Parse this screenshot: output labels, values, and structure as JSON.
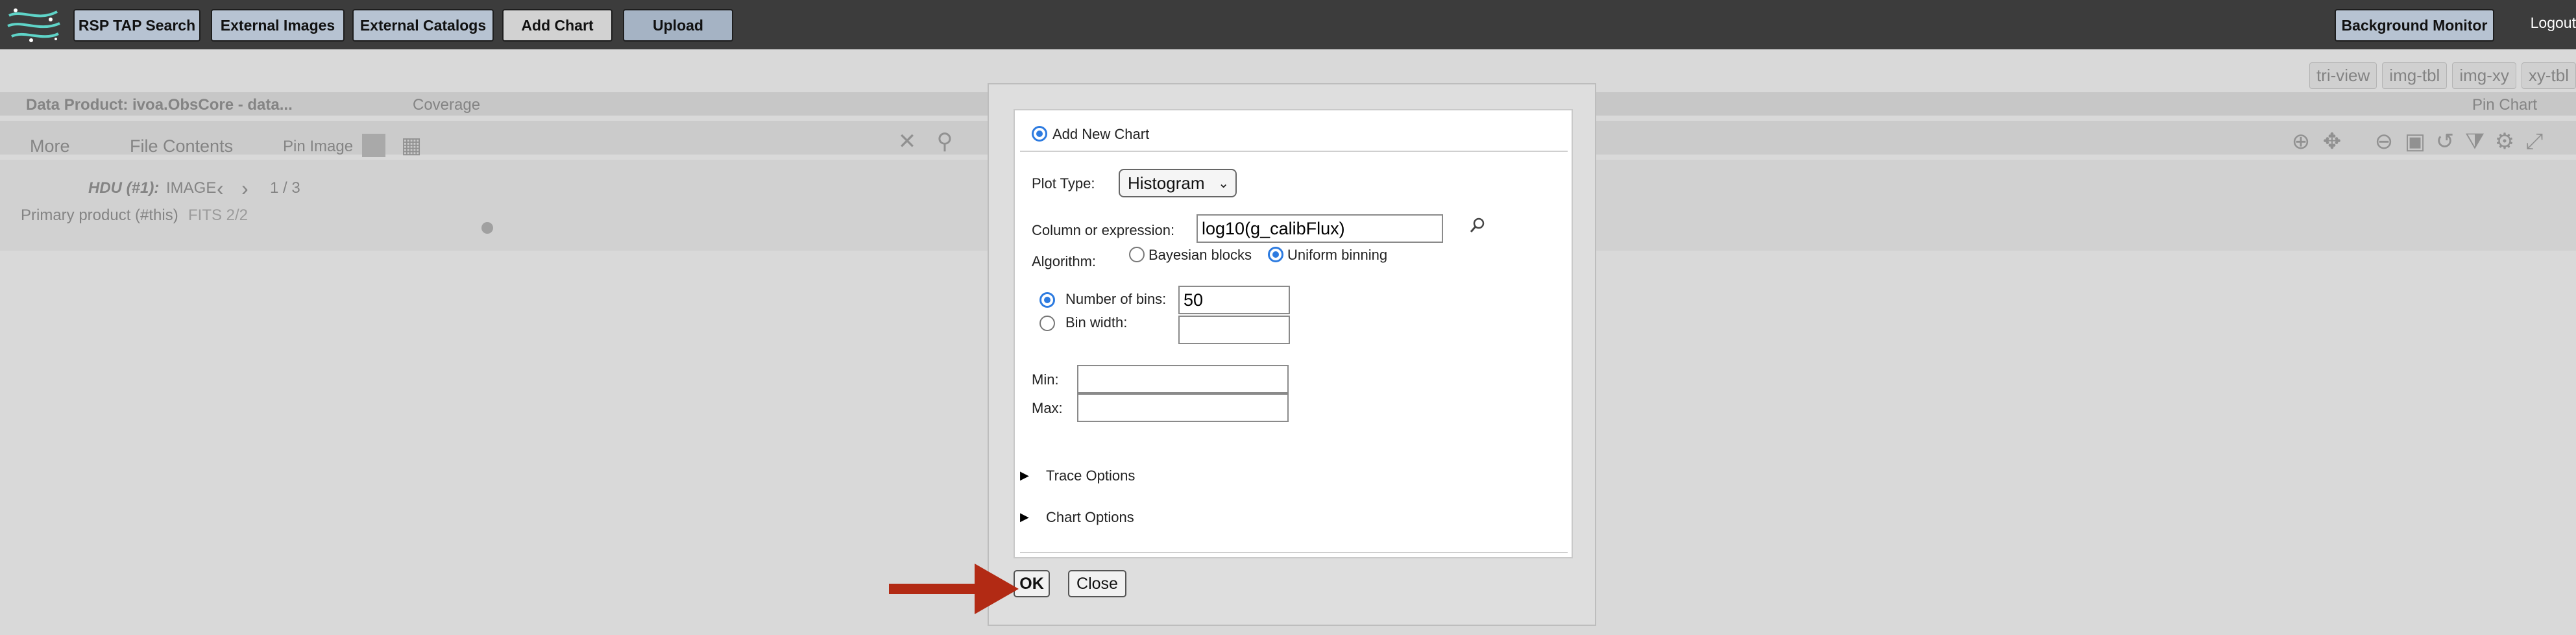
{
  "topbar": {
    "buttons": [
      "RSP TAP Search",
      "External Images",
      "External Catalogs",
      "Add Chart",
      "Upload"
    ],
    "background_monitor": "Background Monitor",
    "logout": "Logout"
  },
  "background": {
    "view_tabs": [
      "tri-view",
      "img-tbl",
      "img-xy",
      "xy-tbl"
    ],
    "data_product": "Data Product: ivoa.ObsCore - data...",
    "coverage": "Coverage",
    "pin_chart": "Pin Chart",
    "more": "More",
    "file_contents": "File Contents",
    "pin_image": "Pin Image",
    "hdu_label": "HDU (#1):",
    "hdu_type": "IMAGE",
    "hdu_page": "1 / 3",
    "primary_product": "Primary product (#this)",
    "primary_extra": "FITS 2/2"
  },
  "dialog": {
    "add_new_chart": "Add New Chart",
    "plot_type_label": "Plot Type:",
    "plot_type_value": "Histogram",
    "column_label": "Column or expression:",
    "column_value": "log10(g_calibFlux)",
    "algorithm_label": "Algorithm:",
    "algorithm_options": [
      "Bayesian blocks",
      "Uniform binning"
    ],
    "algorithm_selected": "Uniform binning",
    "num_bins_label": "Number of bins:",
    "num_bins_value": "50",
    "bin_width_label": "Bin width:",
    "bin_width_value": "",
    "min_label": "Min:",
    "min_value": "",
    "max_label": "Max:",
    "max_value": "",
    "trace_options": "Trace Options",
    "chart_options": "Chart Options",
    "ok": "OK",
    "close": "Close"
  },
  "colors": {
    "topbar": "#3c3c3c",
    "button": "#b7c3d2",
    "radio_selected": "#2d7be0",
    "arrow": "#b22a14"
  },
  "icons": [
    "app-logo-icon",
    "magnifier-icon",
    "arrow-pointer-icon",
    "expand-triangle-icon"
  ]
}
